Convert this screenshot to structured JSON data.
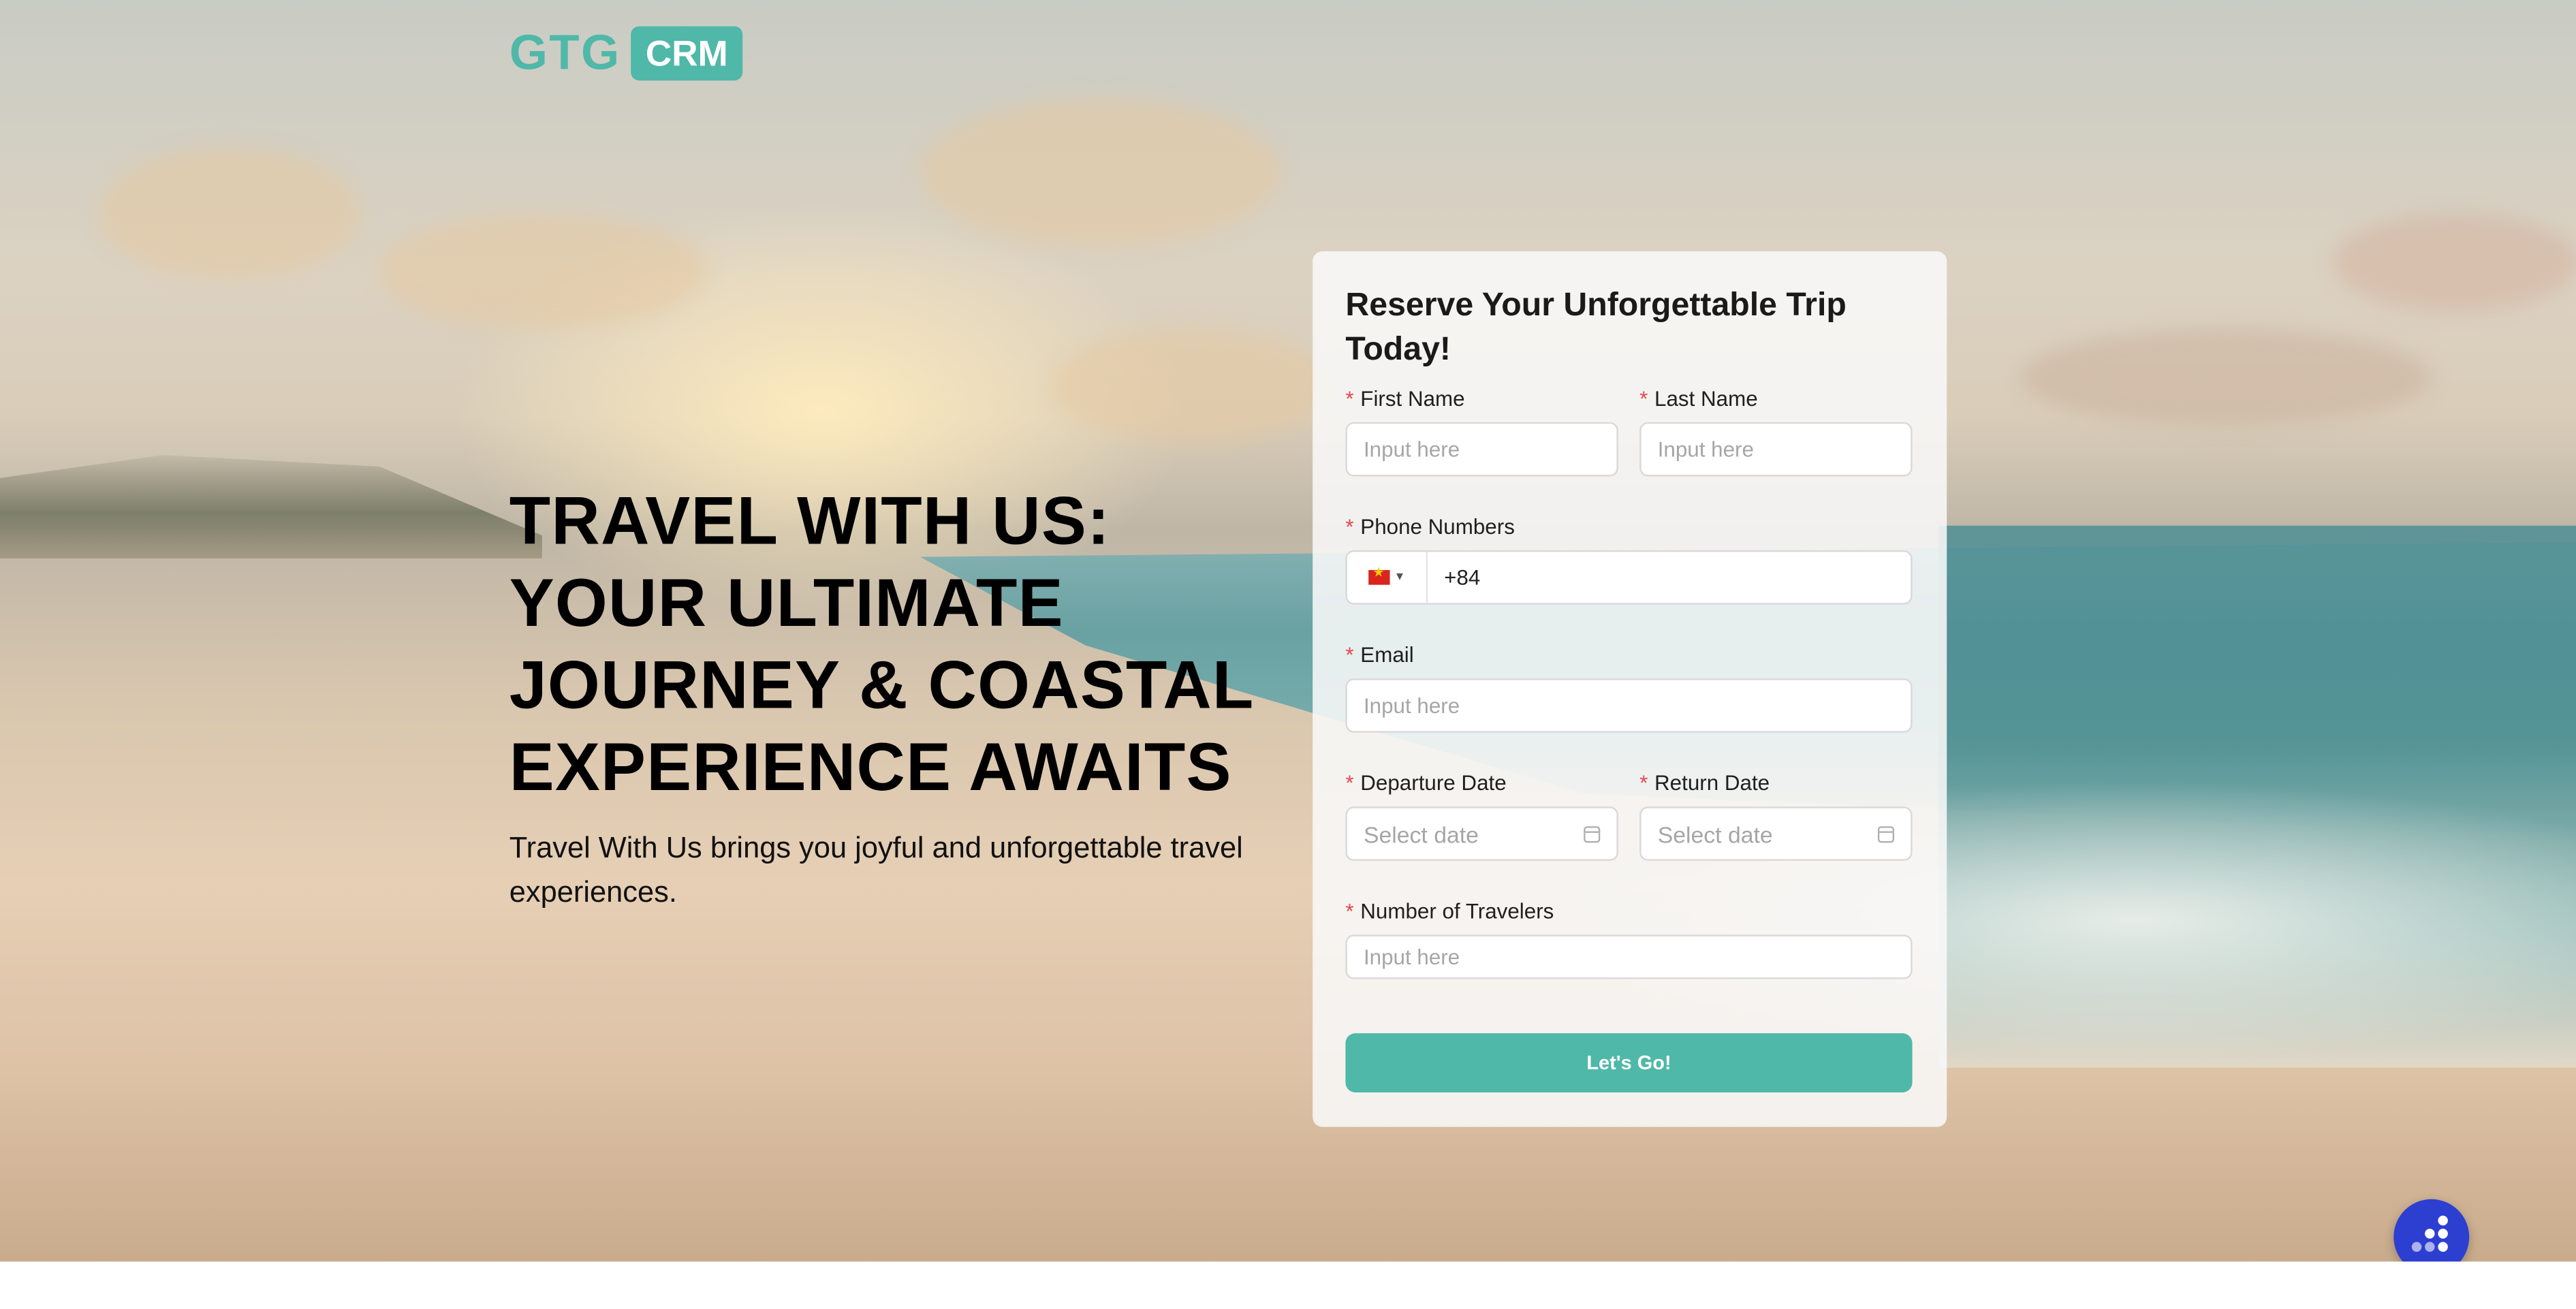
{
  "brand": {
    "logo_left": "GTG",
    "logo_right": "CRM",
    "accent_color": "#4fb8a8"
  },
  "hero": {
    "headline_lines": [
      "TRAVEL WITH US:",
      "YOUR ULTIMATE",
      "JOURNEY & COASTAL",
      "EXPERIENCE AWAITS"
    ],
    "subtext": "Travel With Us brings you joyful and unforgettable travel experiences."
  },
  "form": {
    "title": "Reserve Your Unforgettable Trip Today!",
    "required_marker": "*",
    "first_name": {
      "label": "First Name",
      "placeholder": "Input here",
      "value": ""
    },
    "last_name": {
      "label": "Last Name",
      "placeholder": "Input here",
      "value": ""
    },
    "phone": {
      "label": "Phone Numbers",
      "country_flag": "vietnam-flag-icon",
      "code": "+84"
    },
    "email": {
      "label": "Email",
      "placeholder": "Input here",
      "value": ""
    },
    "departure_date": {
      "label": "Departure Date",
      "placeholder": "Select date"
    },
    "return_date": {
      "label": "Return Date",
      "placeholder": "Select date"
    },
    "travelers": {
      "label": "Number of Travelers",
      "placeholder": "Input here",
      "value": ""
    },
    "submit_label": "Let's Go!"
  },
  "chat_widget": {
    "icon": "chat-dots-icon",
    "color": "#2d3fd1"
  }
}
